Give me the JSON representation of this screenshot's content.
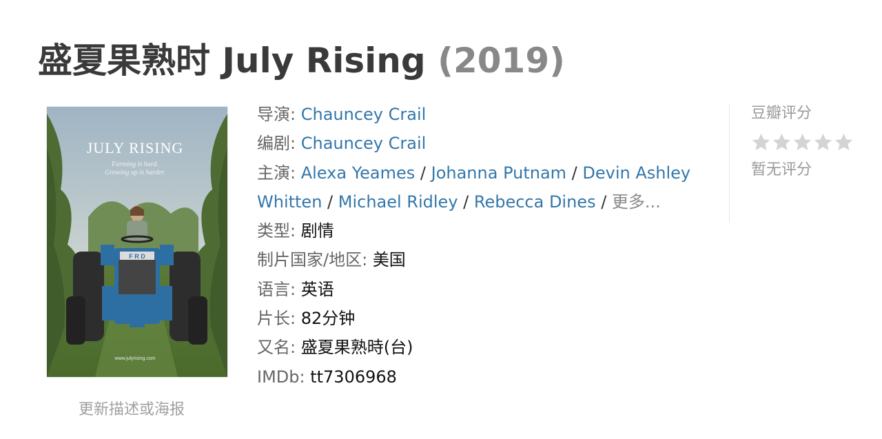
{
  "title": {
    "name": "盛夏果熟时 July Rising",
    "year": "(2019)"
  },
  "poster": {
    "title": "JULY RISING",
    "tagline1": "Farming is hard.",
    "tagline2": "Growing up is harder.",
    "website": "www.julyrising.com",
    "tractor_badge": "F  R  D"
  },
  "update_link": "更新描述或海报",
  "info": {
    "director_label": "导演",
    "director": "Chauncey Crail",
    "writer_label": "编剧",
    "writer": "Chauncey Crail",
    "cast_label": "主演",
    "cast": [
      "Alexa Yeames",
      "Johanna Putnam",
      "Devin Ashley Whitten",
      "Michael Ridley",
      "Rebecca Dines"
    ],
    "cast_more": "更多...",
    "genre_label": "类型",
    "genre": "剧情",
    "country_label": "制片国家/地区",
    "country": "美国",
    "language_label": "语言",
    "language": "英语",
    "runtime_label": "片长",
    "runtime": "82分钟",
    "aka_label": "又名",
    "aka": "盛夏果熟時(台)",
    "imdb_label": "IMDb",
    "imdb": "tt7306968"
  },
  "rating": {
    "label": "豆瓣评分",
    "stars": 0,
    "no_rating": "暂无评分",
    "star_color": "#d4d4d4"
  }
}
